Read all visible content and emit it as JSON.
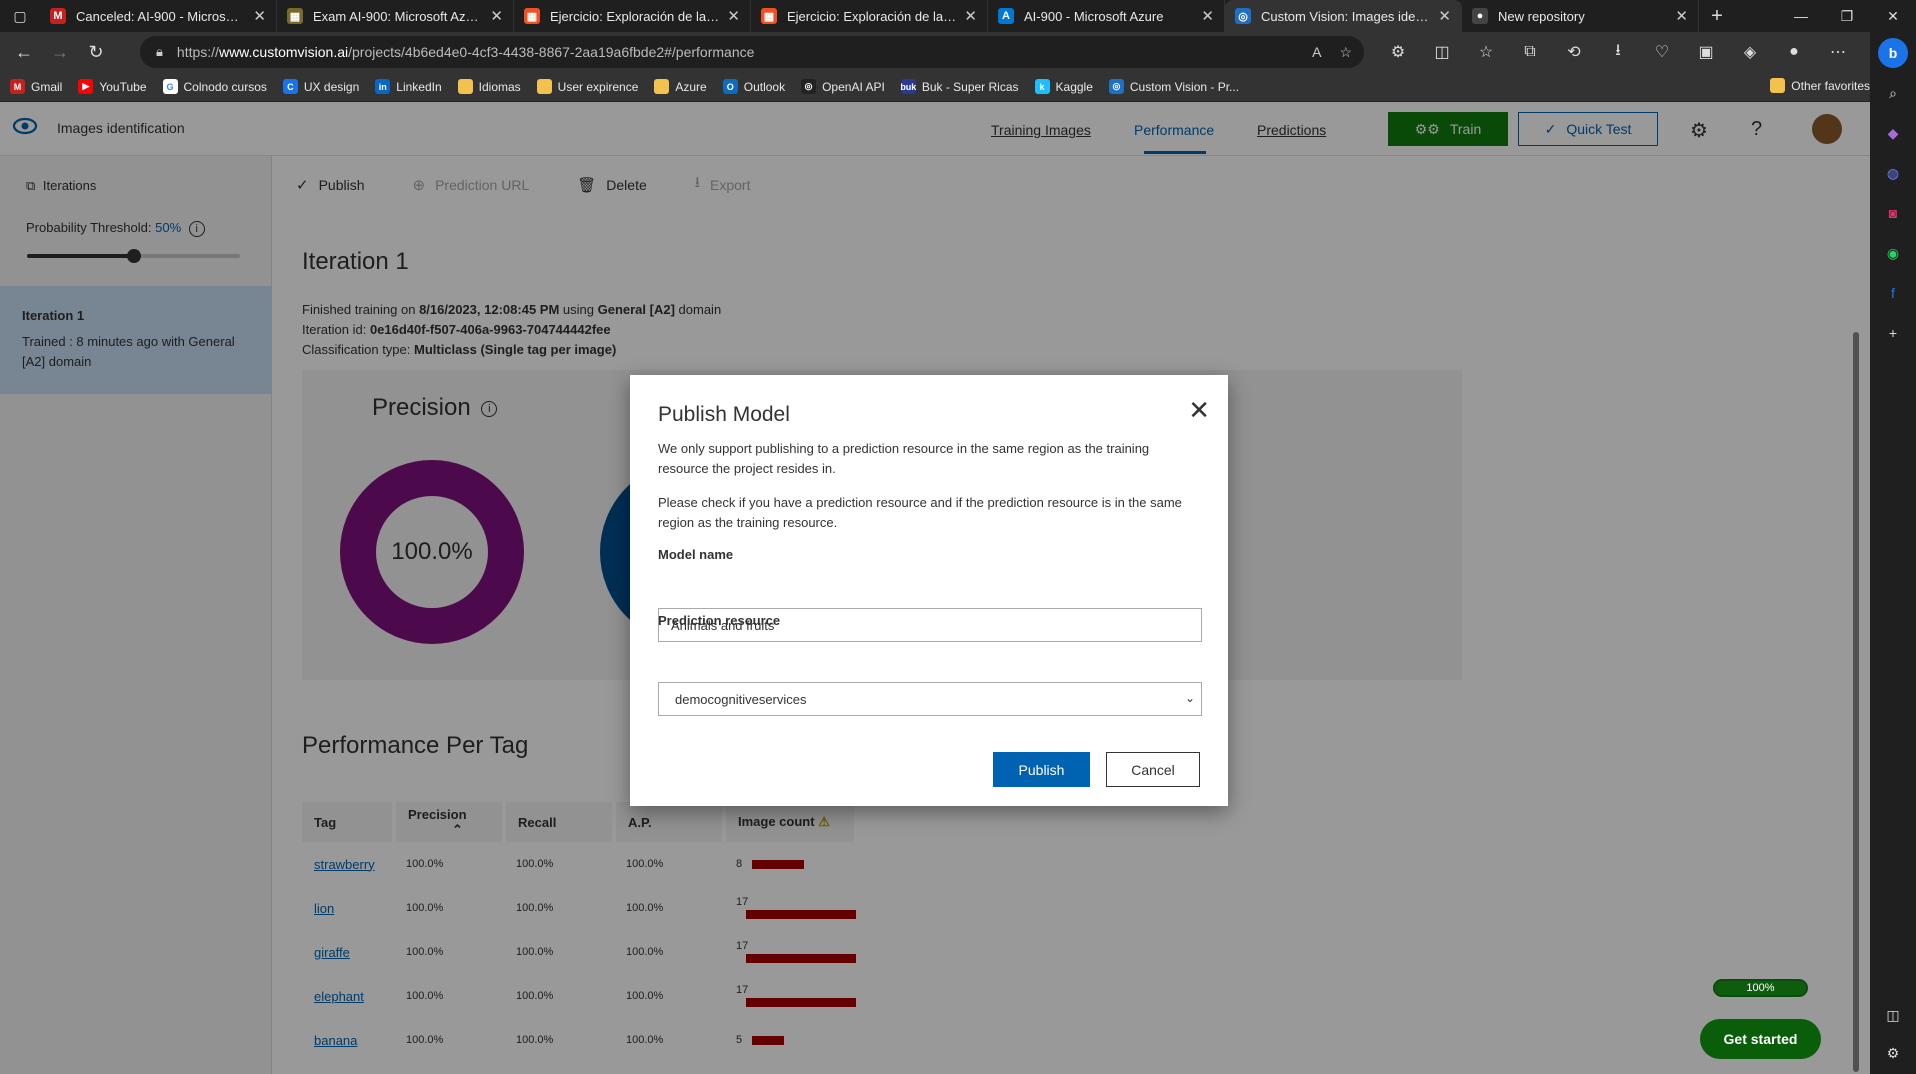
{
  "browser": {
    "tabs": [
      {
        "title": "Canceled: AI-900 - Microsoft Azu",
        "icon": "gmail",
        "color": "#c5221f",
        "glyph": "M"
      },
      {
        "title": "Exam AI-900: Microsoft Azure AI",
        "icon": "microsoft",
        "color": "#7a6a2a",
        "glyph": "▦"
      },
      {
        "title": "Ejercicio: Exploración de la clasif",
        "icon": "microsoft",
        "color": "#f25022",
        "glyph": "▦"
      },
      {
        "title": "Ejercicio: Exploración de la tradu",
        "icon": "microsoft",
        "color": "#f25022",
        "glyph": "▦"
      },
      {
        "title": "AI-900 - Microsoft Azure",
        "icon": "azure",
        "color": "#0078d4",
        "glyph": "A"
      },
      {
        "title": "Custom Vision: Images identifica",
        "icon": "customvision",
        "color": "#1f6fc4",
        "glyph": "◎"
      },
      {
        "title": "New repository",
        "icon": "github",
        "color": "#444",
        "glyph": "●"
      }
    ],
    "url_prefix": "https://",
    "url_host": "www.customvision.ai",
    "url_path": "/projects/4b6ed4e0-4cf3-4438-8867-2aa19a6fbde2#/performance",
    "bookmarks": [
      {
        "label": "Gmail",
        "color": "#c5221f",
        "glyph": "M"
      },
      {
        "label": "YouTube",
        "color": "#ff0000",
        "glyph": "▶"
      },
      {
        "label": "Colnodo cursos",
        "color": "#fff",
        "glyph": "G"
      },
      {
        "label": "UX design",
        "color": "#1a73e8",
        "glyph": "C"
      },
      {
        "label": "LinkedIn",
        "color": "#0a66c2",
        "glyph": "in"
      },
      {
        "label": "Idiomas",
        "color": "#f2c14e",
        "glyph": ""
      },
      {
        "label": "User expirence",
        "color": "#f2c14e",
        "glyph": ""
      },
      {
        "label": "Azure",
        "color": "#f2c14e",
        "glyph": ""
      },
      {
        "label": "Outlook",
        "color": "#0f6cbd",
        "glyph": "O"
      },
      {
        "label": "OpenAI API",
        "color": "#222",
        "glyph": "◎"
      },
      {
        "label": "Buk - Super Ricas",
        "color": "#2b3a8f",
        "glyph": "buk"
      },
      {
        "label": "Kaggle",
        "color": "#20beff",
        "glyph": "k"
      },
      {
        "label": "Custom Vision - Pr...",
        "color": "#1f6fc4",
        "glyph": "◎"
      }
    ],
    "other_favorites": "Other favorites"
  },
  "app": {
    "project_name": "Images identification",
    "nav": {
      "training": "Training Images",
      "performance": "Performance",
      "predictions": "Predictions"
    },
    "train_label": "Train",
    "quick_test_label": "Quick Test"
  },
  "left": {
    "iterations_label": "Iterations",
    "threshold_label": "Probability Threshold:",
    "threshold_value": "50%",
    "threshold_fraction": 0.5,
    "iteration_name": "Iteration 1",
    "iteration_desc": "Trained : 8 minutes ago with General [A2] domain"
  },
  "main": {
    "toolbar": {
      "publish": "Publish",
      "prediction_url": "Prediction URL",
      "delete": "Delete",
      "export": "Export"
    },
    "title": "Iteration 1",
    "finished_prefix": "Finished training on ",
    "finished_date": "8/16/2023, 12:08:45 PM",
    "finished_using": " using ",
    "finished_domain": "General [A2]",
    "finished_suffix": " domain",
    "iteration_id_label": "Iteration id: ",
    "iteration_id": "0e16d40f-f507-406a-9963-704744442fee",
    "class_type_label": "Classification type: ",
    "class_type": "Multiclass (Single tag per image)",
    "precision_label": "Precision",
    "precision_value": "100.0%",
    "ppt_title": "Performance Per Tag",
    "columns": [
      "Tag",
      "Precision",
      "Recall",
      "A.P.",
      "Image count"
    ],
    "rows": [
      {
        "tag": "strawberry",
        "precision": "100.0%",
        "recall": "100.0%",
        "ap": "100.0%",
        "count": "8",
        "count_n": 8
      },
      {
        "tag": "lion",
        "precision": "100.0%",
        "recall": "100.0%",
        "ap": "100.0%",
        "count": "17",
        "count_n": 17
      },
      {
        "tag": "giraffe",
        "precision": "100.0%",
        "recall": "100.0%",
        "ap": "100.0%",
        "count": "17",
        "count_n": 17
      },
      {
        "tag": "elephant",
        "precision": "100.0%",
        "recall": "100.0%",
        "ap": "100.0%",
        "count": "17",
        "count_n": 17
      },
      {
        "tag": "banana",
        "precision": "100.0%",
        "recall": "100.0%",
        "ap": "100.0%",
        "count": "5",
        "count_n": 5
      }
    ]
  },
  "modal": {
    "title": "Publish Model",
    "text1": "We only support publishing to a prediction resource in the same region as the training resource the project resides in.",
    "text2": "Please check if you have a prediction resource and if the prediction resource is in the same region as the training resource.",
    "model_name_label": "Model name",
    "model_name_value": "Animals and fruits",
    "resource_label": "Prediction resource",
    "resource_value": "democognitiveservices",
    "publish": "Publish",
    "cancel": "Cancel"
  },
  "widgets": {
    "progress": "100%",
    "get_started": "Get started"
  }
}
